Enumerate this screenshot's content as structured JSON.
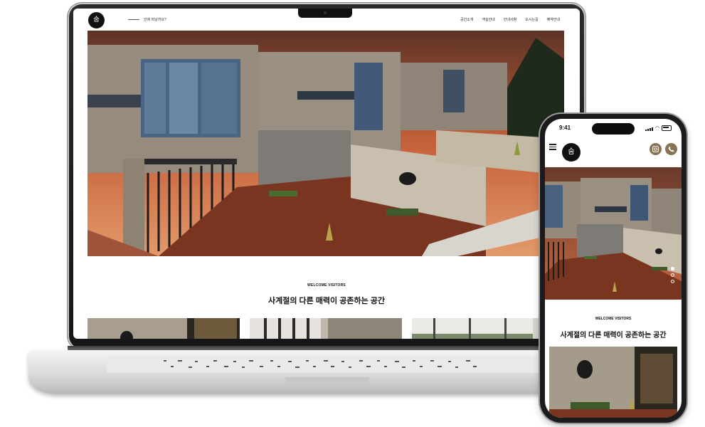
{
  "site": {
    "logo_text": "숨",
    "tagline": "언제 떠날까요?",
    "nav": [
      "공간소개",
      "객실안내",
      "안내사항",
      "오시는길",
      "예약안내"
    ]
  },
  "welcome": {
    "eyebrow": "WELCOME VISITORS",
    "headline": "사계절의 다른 매력이 공존하는 공간"
  },
  "mobile": {
    "status_time": "9:41",
    "logo_text": "숨",
    "instagram_icon": "instagram-icon",
    "phone_icon": "phone-icon",
    "eyebrow": "WELCOME VISITORS",
    "headline": "사계절의 다른 매력이 공존하는 공간",
    "slider_pages": 3,
    "slider_active": 1
  },
  "colors": {
    "accent": "#8a7355",
    "sky_top": "#6f3a2a",
    "sky_glow": "#d9713f",
    "deck": "#7a3520",
    "concrete": "#9d9283"
  }
}
